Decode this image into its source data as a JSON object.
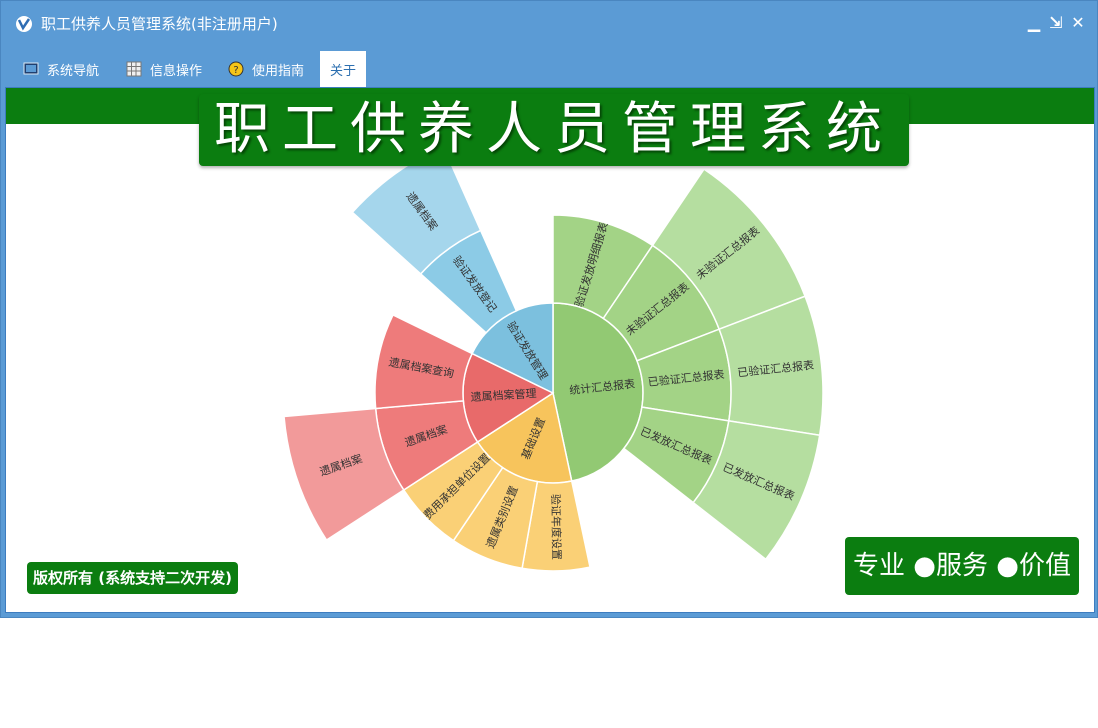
{
  "window": {
    "title": "职工供养人员管理系统(非注册用户)",
    "buttons": {
      "minimize": "▁",
      "restore": "⇲",
      "close": "✕"
    }
  },
  "menu": [
    {
      "label": "系统导航",
      "icon": "monitor-icon"
    },
    {
      "label": "信息操作",
      "icon": "grid-icon"
    },
    {
      "label": "使用指南",
      "icon": "help-icon"
    },
    {
      "label": "关于",
      "icon": ""
    }
  ],
  "banner": {
    "title": "职工供养人员管理系统"
  },
  "footer": {
    "copyright": "版权所有 (系统支持二次开发)",
    "slogan": "专业 ●服务 ●价值"
  },
  "colors": {
    "window": "#5b9bd5",
    "banner": "#0b7d10",
    "green": "#92c973",
    "blue": "#7cc0de",
    "red": "#e86a6a",
    "orange": "#f7c45c"
  },
  "sunburst": {
    "inner": [
      {
        "label": "统计汇总报表",
        "color": "#92c973"
      },
      {
        "label": "基础设置",
        "color": "#f7c45c"
      },
      {
        "label": "遗属档案管理",
        "color": "#e86a6a"
      },
      {
        "label": "验证发放管理",
        "color": "#7cc0de"
      }
    ],
    "middle": [
      {
        "label": "验证发放明细报表",
        "color": "#a3d386"
      },
      {
        "label": "未验证汇总报表",
        "color": "#a3d386"
      },
      {
        "label": "已验证汇总报表",
        "color": "#a3d386"
      },
      {
        "label": "已发放汇总报表",
        "color": "#a3d386"
      },
      {
        "label": "验证年度设置",
        "color": "#fad076"
      },
      {
        "label": "遗属类别设置",
        "color": "#fad076"
      },
      {
        "label": "费用承担单位设置",
        "color": "#fad076"
      },
      {
        "label": "遗属档案",
        "color": "#ee7b7b"
      },
      {
        "label": "遗属档案查询",
        "color": "#ee7b7b"
      },
      {
        "label": "验证发放登记",
        "color": "#8ccbe6"
      }
    ],
    "outer": [
      {
        "label": "未验证汇总报表",
        "color": "#b5dea0"
      },
      {
        "label": "已验证汇总报表",
        "color": "#b5dea0"
      },
      {
        "label": "已发放汇总报表",
        "color": "#b5dea0"
      },
      {
        "label": "遗属档案",
        "color": "#f29a9a"
      },
      {
        "label": "遗属档案",
        "color": "#a5d6ec"
      }
    ]
  }
}
